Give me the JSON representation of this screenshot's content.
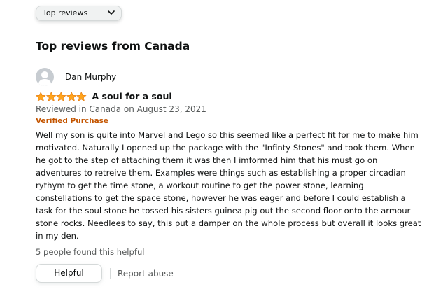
{
  "sort": {
    "selected": "Top reviews",
    "icon": "chevron-down-icon"
  },
  "section_title": "Top reviews from Canada",
  "review": {
    "author": "Dan Murphy",
    "avatar_icon": "user-avatar-icon",
    "rating": 5,
    "rating_max": 5,
    "star_color": "#ffa41c",
    "title": "A soul for a soul",
    "date_line": "Reviewed in Canada on August 23, 2021",
    "badge": "Verified Purchase",
    "badge_color": "#c45500",
    "body": "Well my son is quite into Marvel and Lego so this seemed like a perfect fit for me to make him motivated. Naturally I opened up the package with the \"Infinty Stones\" and took them. When he got to the step of attaching them it was then I imformed him that his must go on adventures to retreive them. Examples were things such as establishing a proper circadian rythym to get the time stone, a workout routine to get the power stone, learning constellations to get the space stone, however he was eager and before I could establish a task for the soul stone he tossed his sisters guinea pig out the second floor onto the armour stone rocks. Needlees to say, this put a damper on the whole process but overall it looks great in my den.",
    "helpful_count": "5 people found this helpful",
    "helpful_button": "Helpful",
    "report_link": "Report abuse"
  }
}
